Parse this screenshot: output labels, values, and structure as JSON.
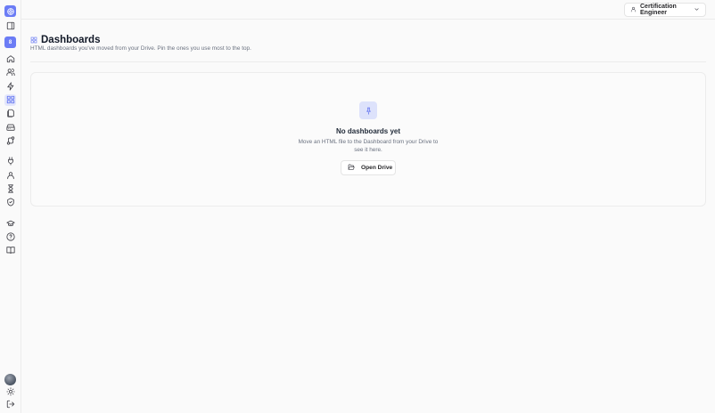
{
  "sidebar": {
    "workspace_initial": "8",
    "items": [
      {
        "name": "collapse-sidebar",
        "icon": "panel-icon"
      },
      {
        "name": "home",
        "icon": "home-icon"
      },
      {
        "name": "users",
        "icon": "users-icon"
      },
      {
        "name": "automations",
        "icon": "lightning-icon"
      },
      {
        "name": "dashboards",
        "icon": "grid-icon",
        "active": true
      },
      {
        "name": "documents",
        "icon": "files-icon"
      },
      {
        "name": "drive",
        "icon": "drive-icon"
      },
      {
        "name": "workflows",
        "icon": "route-icon"
      },
      {
        "name": "integrations",
        "icon": "plug-icon"
      },
      {
        "name": "profile",
        "icon": "person-icon"
      },
      {
        "name": "history",
        "icon": "hourglass-icon"
      },
      {
        "name": "security",
        "icon": "shield-icon"
      },
      {
        "name": "learning",
        "icon": "graduation-cap-icon"
      },
      {
        "name": "help",
        "icon": "help-icon"
      },
      {
        "name": "docs",
        "icon": "book-icon"
      },
      {
        "name": "theme",
        "icon": "sun-icon"
      },
      {
        "name": "logout",
        "icon": "logout-icon"
      }
    ]
  },
  "topbar": {
    "user_label": "Certification Engineer"
  },
  "header": {
    "title": "Dashboards",
    "subtitle": "HTML dashboards you've moved from your Drive. Pin the ones you use most to the top."
  },
  "empty_state": {
    "title": "No dashboards yet",
    "description": "Move an HTML file to the Dashboard from your Drive to see it here.",
    "button_label": "Open Drive"
  },
  "colors": {
    "accent": "#6b7cf5",
    "accent_soft": "#dde2fb",
    "border": "#ececec"
  }
}
